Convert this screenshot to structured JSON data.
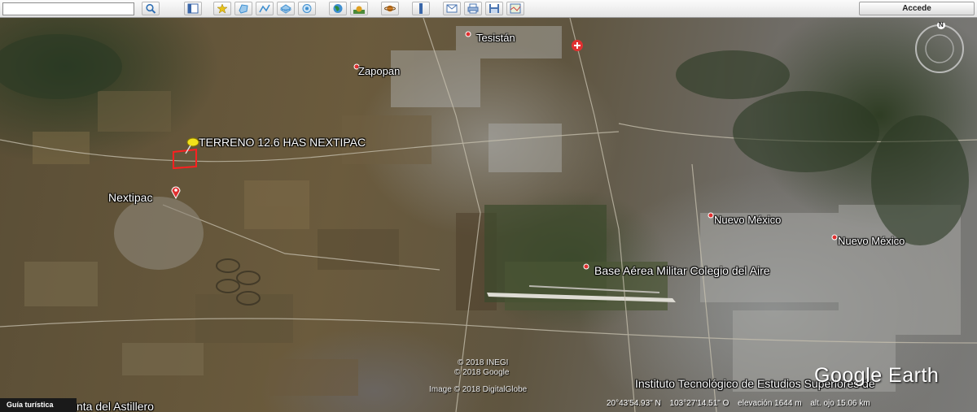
{
  "search": {
    "value": "",
    "placeholder": ""
  },
  "toolbar": {
    "buttons": [
      {
        "icon": "search-icon",
        "color": "#2f6fb3"
      },
      {
        "icon": "sidebar-toggle-icon",
        "color": "#3a66a8"
      },
      {
        "icon": "add-placemark-icon",
        "color": "#e8c21a"
      },
      {
        "icon": "add-polygon-icon",
        "color": "#3f8fd0"
      },
      {
        "icon": "add-path-icon",
        "color": "#3f8fd0"
      },
      {
        "icon": "add-image-overlay-icon",
        "color": "#3f8fd0"
      },
      {
        "icon": "record-tour-icon",
        "color": "#3f8fd0"
      },
      {
        "icon": "historical-imagery-icon",
        "color": "#2e8b3a"
      },
      {
        "icon": "sunlight-icon",
        "color": "#e0a020"
      },
      {
        "icon": "planets-icon",
        "color": "#d07a20"
      },
      {
        "icon": "ruler-icon",
        "color": "#3a66a8"
      },
      {
        "icon": "email-icon",
        "color": "#4a74b0"
      },
      {
        "icon": "print-icon",
        "color": "#4a74b0"
      },
      {
        "icon": "save-image-icon",
        "color": "#4a74b0"
      },
      {
        "icon": "view-in-maps-icon",
        "color": "#4a74b0"
      }
    ],
    "accede_label": "Accede"
  },
  "map": {
    "labels": {
      "tesistan": "Tesistán",
      "zapopan": "Zapopan",
      "terreno": "TERRENO 12.6 HAS NEXTIPAC",
      "nextipac": "Nextipac",
      "nuevo_mexico_1": "Nuevo México",
      "nuevo_mexico_2": "Nuevo México",
      "base_aerea": "Base Aérea Militar Colegio del Aire",
      "instituto": "Instituto Tecnológico de Estudios Superiores de",
      "astillero": "nta del Astillero"
    },
    "credits": {
      "inegi": "© 2018 INEGI",
      "google": "© 2018 Google",
      "digitalglobe": "Image © 2018 DigitalGlobe"
    },
    "brand": "Google Earth",
    "compass_north": "N",
    "status": {
      "lat": "20°43'54.93\" N",
      "lon": "103°27'14.51\" O",
      "elevation": "elevación  1644 m",
      "eye_alt": "alt. ojo  15.06 km"
    },
    "guide_label": "Guía turística",
    "colors": {
      "placemark": "#e03030",
      "pushpin": "#f3e21a",
      "polygon": "#ff2020"
    }
  }
}
